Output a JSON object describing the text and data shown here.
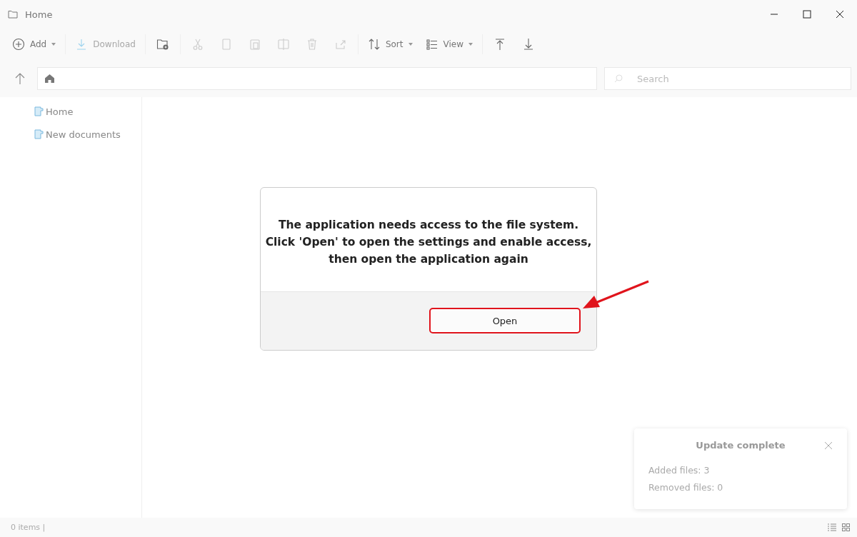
{
  "window": {
    "title": "Home"
  },
  "toolbar": [
    {
      "label": "Add",
      "dropdown": true,
      "disabled": false
    },
    {
      "label": "Download",
      "dropdown": false,
      "disabled": true
    },
    {
      "dropdown": false,
      "disabled": false
    },
    {
      "dropdown": false,
      "disabled": true
    },
    {
      "dropdown": false,
      "disabled": true
    },
    {
      "dropdown": false,
      "disabled": true
    },
    {
      "dropdown": false,
      "disabled": true
    },
    {
      "dropdown": false,
      "disabled": true
    },
    {
      "dropdown": false,
      "disabled": true
    },
    {
      "label": "Sort",
      "dropdown": true,
      "disabled": false
    },
    {
      "label": "View",
      "dropdown": true,
      "disabled": false
    },
    {
      "dropdown": false,
      "disabled": false
    },
    {
      "dropdown": false,
      "disabled": false
    }
  ],
  "search": {
    "placeholder": "Search"
  },
  "sidebar": {
    "items": [
      {
        "label": "Home",
        "selected": false
      },
      {
        "label": "New documents",
        "selected": false
      }
    ]
  },
  "dialog": {
    "message": "The application needs access to the file system.\nClick 'Open' to open the settings and enable access,\nthen open the application again",
    "button": "Open",
    "highlighted": true
  },
  "toast": {
    "title": "Update complete",
    "lines": [
      "Added files:  3",
      "Removed files:  0"
    ]
  },
  "status_bar": {
    "text": "0 items |"
  }
}
